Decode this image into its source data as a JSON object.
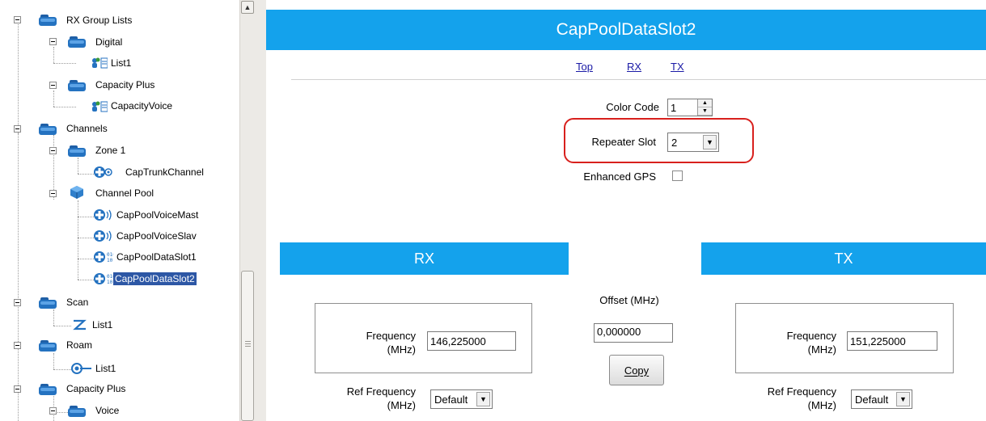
{
  "tree": {
    "rx_group_lists": "RX Group Lists",
    "digital": "Digital",
    "list1": "List1",
    "capacity_plus_group": "Capacity Plus",
    "capacity_voice": "CapacityVoice",
    "channels": "Channels",
    "zone1": "Zone 1",
    "cap_trunk_channel": "CapTrunkChannel",
    "channel_pool": "Channel Pool",
    "pool_voice_mast": "CapPoolVoiceMast",
    "pool_voice_slav": "CapPoolVoiceSlav",
    "pool_data_slot1": "CapPoolDataSlot1",
    "pool_data_slot2": "CapPoolDataSlot2",
    "scan": "Scan",
    "scan_list1": "List1",
    "roam": "Roam",
    "roam_list1": "List1",
    "capacity_plus": "Capacity Plus",
    "voice": "Voice"
  },
  "main": {
    "title": "CapPoolDataSlot2",
    "nav": {
      "top": "Top",
      "rx": "RX",
      "tx": "TX"
    },
    "color_code_label": "Color Code",
    "color_code_value": "1",
    "repeater_slot_label": "Repeater Slot",
    "repeater_slot_value": "2",
    "enhanced_gps_label": "Enhanced GPS",
    "enhanced_gps_checked": false,
    "rx": {
      "header": "RX",
      "frequency_label_1": "Frequency",
      "frequency_label_2": "(MHz)",
      "frequency_value": "146,225000",
      "ref_frequency_label_1": "Ref Frequency",
      "ref_frequency_label_2": "(MHz)",
      "ref_frequency_value": "Default"
    },
    "offset": {
      "label": "Offset (MHz)",
      "value": "0,000000",
      "copy_button": "Copy"
    },
    "tx": {
      "header": "TX",
      "frequency_label_1": "Frequency",
      "frequency_label_2": "(MHz)",
      "frequency_value": "151,225000",
      "ref_frequency_label_1": "Ref Frequency",
      "ref_frequency_label_2": "(MHz)",
      "ref_frequency_value": "Default"
    }
  },
  "colors": {
    "accent": "#14a2ec",
    "selection": "#2d57a5",
    "highlight_outline": "#d8201d",
    "folder": "#2472c0"
  },
  "icons": {
    "folder": "folder-icon",
    "contact_list": "contact-list-icon",
    "trunk_channel": "trunk-channel-icon",
    "channel_pool": "channel-pool-icon",
    "voice_channel": "voice-channel-icon",
    "data_channel": "data-channel-icon",
    "scan": "scan-icon",
    "roam": "roam-icon"
  }
}
